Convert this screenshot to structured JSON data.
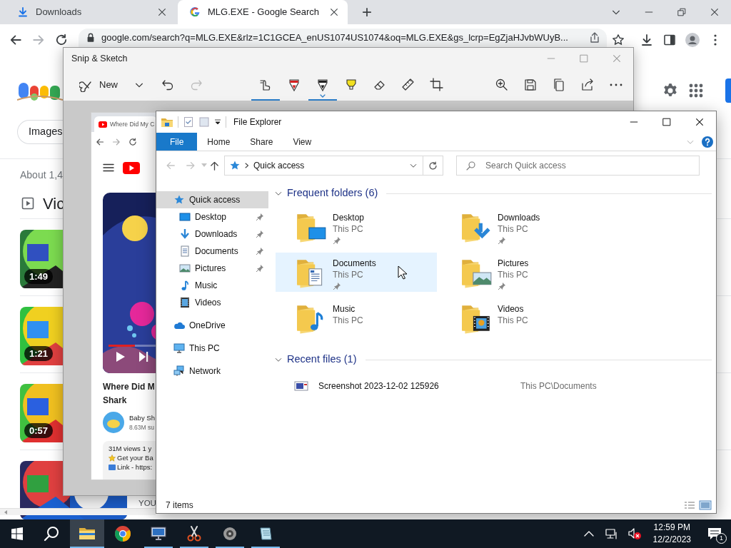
{
  "browser": {
    "tabs": [
      {
        "title": "Downloads",
        "kind": "download",
        "selected": false
      },
      {
        "title": "MLG.EXE - Google Search",
        "kind": "google",
        "selected": true
      }
    ],
    "new_tab": "+",
    "url": "google.com/search?q=MLG.EXE&rlz=1C1GCEA_enUS1074US1074&oq=MLG.EXE&gs_lcrp=EgZjaHJvbWUyB..."
  },
  "google": {
    "chips": [
      "Images"
    ],
    "result_stats": "About 1,4",
    "videos_heading": "Vic",
    "videos": [
      {
        "duration": "1:49"
      },
      {
        "duration": "1:21"
      },
      {
        "duration": "0:57"
      },
      {
        "channel": "YOU"
      }
    ]
  },
  "snip": {
    "title": "Snip & Sketch",
    "new_label": "New",
    "touch_writing": {
      "on": true
    },
    "pens": [
      {
        "kind": "ballpoint",
        "color": "#d42020",
        "selected": false
      },
      {
        "kind": "ballpoint",
        "color": "#202020",
        "selected": true
      },
      {
        "kind": "highlighter",
        "color": "#f2e020",
        "selected": false
      }
    ]
  },
  "capture": {
    "tab_title": "Where Did My C",
    "video_title_lines": [
      "Where Did M",
      "Shark"
    ],
    "channel": "Baby Sh",
    "subscribers": "8.63M su",
    "views": "31M views  1 y",
    "description_lines": [
      "Get your Ba",
      "Link - https:"
    ],
    "progress": {
      "level": 0.45
    }
  },
  "explorer": {
    "title": "File Explorer",
    "ribbon_tabs": [
      {
        "label": "File",
        "selected": true
      },
      {
        "label": "Home",
        "selected": false
      },
      {
        "label": "Share",
        "selected": false
      },
      {
        "label": "View",
        "selected": false
      }
    ],
    "address": "Quick access",
    "search": {
      "placeholder": "Search Quick access"
    },
    "nav": [
      {
        "label": "Quick access",
        "kind": "star",
        "selected": true,
        "children": [
          {
            "label": "Desktop",
            "kind": "desktop",
            "pinned": true,
            "selected": false
          },
          {
            "label": "Downloads",
            "kind": "downloads",
            "pinned": true,
            "selected": false
          },
          {
            "label": "Documents",
            "kind": "documents",
            "pinned": true,
            "selected": false
          },
          {
            "label": "Pictures",
            "kind": "pictures",
            "pinned": true,
            "selected": false
          },
          {
            "label": "Music",
            "kind": "music",
            "pinned": false,
            "selected": false
          },
          {
            "label": "Videos",
            "kind": "videos",
            "pinned": false,
            "selected": false
          }
        ]
      },
      {
        "label": "OneDrive",
        "kind": "cloud",
        "selected": false
      },
      {
        "label": "This PC",
        "kind": "pc",
        "selected": false
      },
      {
        "label": "Network",
        "kind": "network",
        "selected": false
      }
    ],
    "frequent": {
      "heading": "Frequent folders (6)",
      "expanded": true,
      "folders": [
        {
          "name": "Desktop",
          "location": "This PC",
          "kind": "desktop",
          "pinned": true,
          "selected": false
        },
        {
          "name": "Downloads",
          "location": "This PC",
          "kind": "downloads",
          "pinned": true,
          "selected": false
        },
        {
          "name": "Documents",
          "location": "This PC",
          "kind": "documents",
          "pinned": true,
          "selected": true
        },
        {
          "name": "Pictures",
          "location": "This PC",
          "kind": "pictures",
          "pinned": true,
          "selected": false
        },
        {
          "name": "Music",
          "location": "This PC",
          "kind": "music",
          "pinned": false,
          "selected": false
        },
        {
          "name": "Videos",
          "location": "This PC",
          "kind": "videos",
          "pinned": false,
          "selected": false
        }
      ]
    },
    "recent": {
      "heading": "Recent files (1)",
      "expanded": true,
      "files": [
        {
          "name": "Screenshot 2023-12-02 125926",
          "location": "This PC\\Documents"
        }
      ]
    },
    "status": "7 items"
  },
  "taskbar": {
    "apps": [
      {
        "kind": "explorer",
        "running": true,
        "active": true
      },
      {
        "kind": "chrome",
        "running": false,
        "active": false
      },
      {
        "kind": "remote",
        "running": true,
        "active": false
      },
      {
        "kind": "snip",
        "running": true,
        "active": false
      },
      {
        "kind": "speakers",
        "running": true,
        "active": false
      },
      {
        "kind": "notepad",
        "running": true,
        "active": false
      }
    ],
    "time": "12:59 PM",
    "date": "12/2/2023",
    "notifications": "1"
  }
}
